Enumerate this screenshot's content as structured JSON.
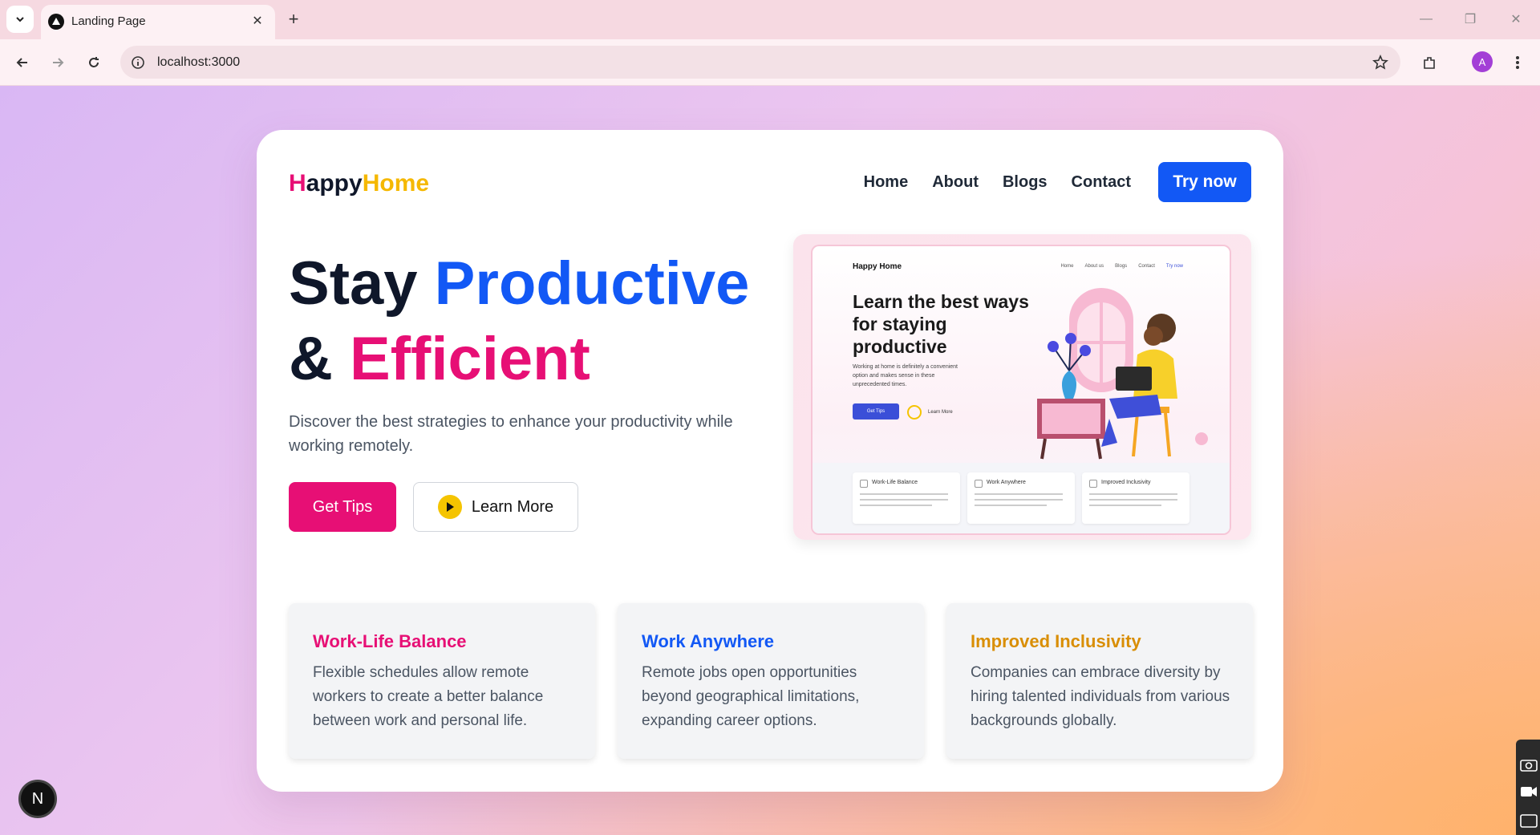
{
  "browser": {
    "tab_title": "Landing Page",
    "url": "localhost:3000",
    "avatar_letter": "A"
  },
  "page": {
    "logo": {
      "h": "H",
      "appy": "appy",
      "home": "Home"
    },
    "nav": [
      "Home",
      "About",
      "Blogs",
      "Contact"
    ],
    "cta": "Try now",
    "hero": {
      "stay": "Stay",
      "productive": "Productive",
      "amp": "&",
      "efficient": "Efficient",
      "subtitle": "Discover the best strategies to enhance your productivity while working remotely.",
      "get_tips": "Get Tips",
      "learn_more": "Learn More"
    },
    "mockup": {
      "logo": "Happy Home",
      "nav": [
        "Home",
        "About us",
        "Blogs",
        "Contact",
        "Try now"
      ],
      "title": "Learn the best ways for staying productive",
      "desc": "Working at home is definitely a convenient option and makes sense in these unprecedented times.",
      "btn": "Get Tips",
      "learn": "Learn More",
      "cards": [
        "Work-Life Balance",
        "Work Anywhere",
        "Improved Inclusivity"
      ]
    },
    "features": [
      {
        "title": "Work-Life Balance",
        "text": "Flexible schedules allow remote workers to create a better balance between work and personal life.",
        "color": "#e70f75"
      },
      {
        "title": "Work Anywhere",
        "text": "Remote jobs open opportunities beyond geographical limitations, expanding career options.",
        "color": "#1258f5"
      },
      {
        "title": "Improved Inclusivity",
        "text": "Companies can embrace diversity by hiring talented individuals from various backgrounds globally.",
        "color": "#d98e04"
      }
    ],
    "dev_badge": "N"
  },
  "colors": {
    "pink": "#e70f75",
    "blue": "#1258f5",
    "gold": "#f5b800"
  }
}
